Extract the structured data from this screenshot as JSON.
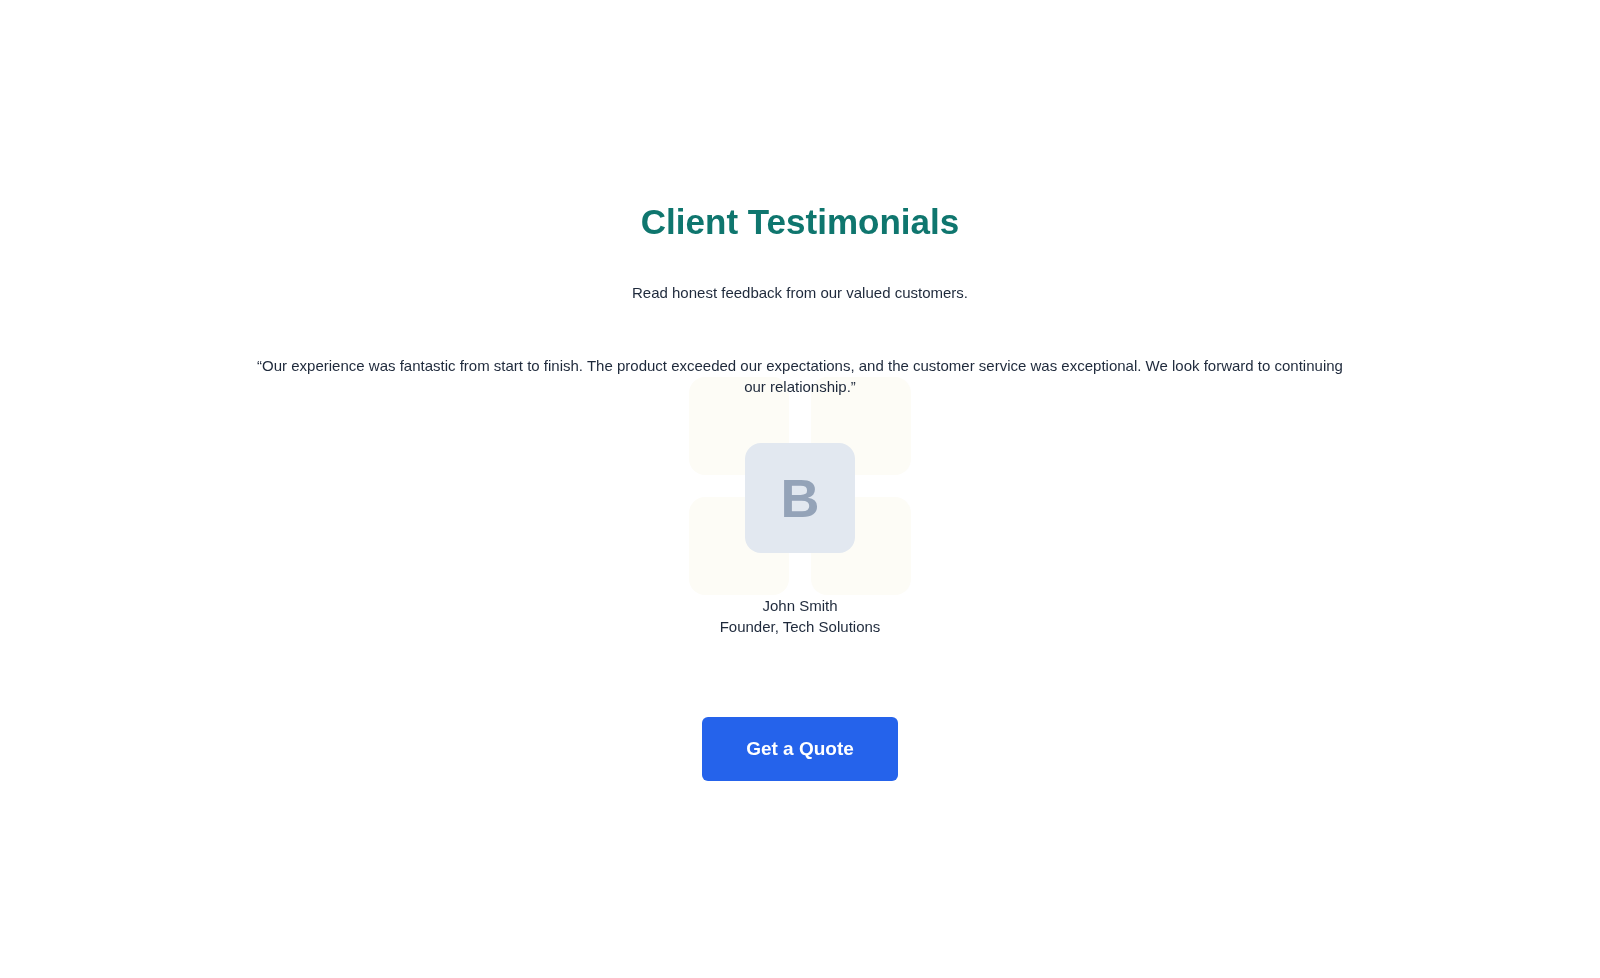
{
  "heading": "Client Testimonials",
  "subheading": "Read honest feedback from our valued customers.",
  "testimonial": {
    "quote": "“Our experience was fantastic from start to finish. The product exceeded our expectations, and the customer service was exceptional. We look forward to continuing our relationship.”",
    "avatar_letter": "B",
    "name": "John Smith",
    "role": "Founder, Tech Solutions"
  },
  "button": "Get a Quote"
}
